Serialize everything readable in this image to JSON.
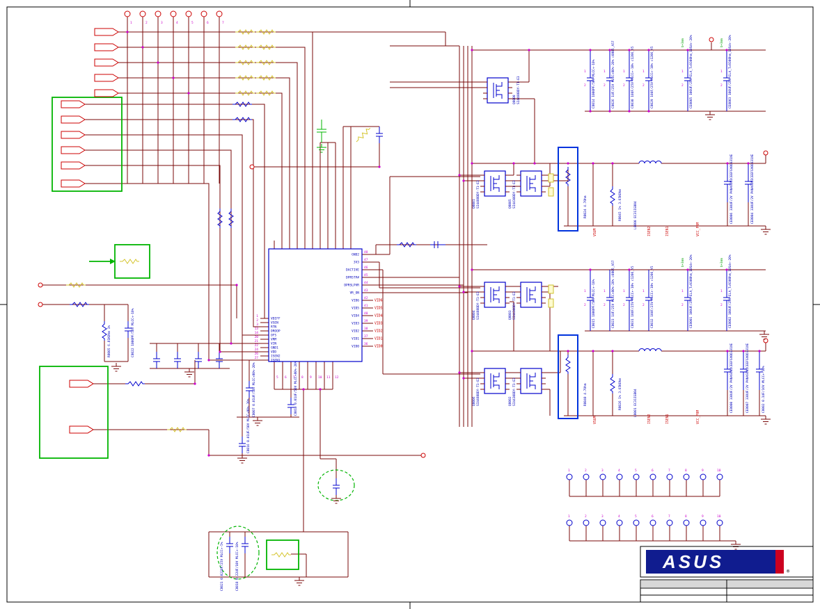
{
  "sheet": {
    "brand": "ASUS",
    "reg": "®"
  },
  "top_header": {
    "pins": [
      "1",
      "2",
      "3",
      "4",
      "5",
      "6",
      "7"
    ]
  },
  "ic": {
    "pins_right": [
      {
        "n": "48",
        "name": "GND2",
        "net": ""
      },
      {
        "n": "47",
        "name": "3V3",
        "net": ""
      },
      {
        "n": "46",
        "name": "DACTIVE",
        "net": ""
      },
      {
        "n": "45",
        "name": "DPRSTP#",
        "net": ""
      },
      {
        "n": "44",
        "name": "DPRSLPVR",
        "net": ""
      },
      {
        "n": "43",
        "name": "VR_ON",
        "net": ""
      },
      {
        "n": "42",
        "name": "VID6",
        "net": "VID6"
      },
      {
        "n": "41",
        "name": "VID5",
        "net": "VID5"
      },
      {
        "n": "40",
        "name": "VID4",
        "net": "VID4"
      },
      {
        "n": "39",
        "name": "VID3",
        "net": "VID3"
      },
      {
        "n": "38",
        "name": "VID2",
        "net": "VID2"
      },
      {
        "n": "37",
        "name": "VID1",
        "net": "VID1"
      },
      {
        "n": "36",
        "name": "VID0",
        "net": "VID0"
      }
    ],
    "pins_left": [
      {
        "n": "1",
        "name": "VDIFF"
      },
      {
        "n": "2",
        "name": "VSEN"
      },
      {
        "n": "3",
        "name": "RTN"
      },
      {
        "n": "13",
        "name": "DROOP"
      },
      {
        "n": "14",
        "name": "OFS"
      },
      {
        "n": "20",
        "name": "VRM"
      },
      {
        "n": "21",
        "name": "VIN"
      },
      {
        "n": "22",
        "name": "GND1"
      },
      {
        "n": "24",
        "name": "VDD"
      },
      {
        "n": "26",
        "name": "ISEN2"
      },
      {
        "n": "27",
        "name": "ISEN1"
      }
    ],
    "pins_bottom": [
      "5",
      "6",
      "7",
      "8",
      "9",
      "10",
      "11",
      "12"
    ]
  },
  "mosfets": [
    {
      "ref": "Q8000",
      "part": "SI4488BDY-T1-E3"
    },
    {
      "ref": "Q8001",
      "part": "SI4488BDY-T1-E3"
    },
    {
      "ref": "Q8005",
      "part": "SI4430BDY-T1-E3"
    },
    {
      "ref": "Q8004",
      "part": "SI4488BDY-T1-E3"
    },
    {
      "ref": "Q8003",
      "part": "SI4430BDY-T1-E3"
    },
    {
      "ref": "Q8006",
      "part": "SI4488BDY-T1-E3"
    },
    {
      "ref": "Q8002",
      "part": "SI4430BDY-T1-E3"
    }
  ],
  "bank1": [
    {
      "t": "C8014 1000PF/50V MLCC+-10%"
    },
    {
      "t": "C8026 1UF/25V MLCC+80%-20% c0805_A57"
    },
    {
      "t": "C8030 10UF/25V MLCC+-10% c1206_Y5"
    },
    {
      "t": "C8029 10UF/25V MLCC+-10% c1206_Y5"
    },
    {
      "t": "CE8005 100UF/25V ELA_T=9300hm_10Sd+-20%"
    },
    {
      "t": "CE8003 100UF/25V ELA_T=9300hm_10Sd+-20%"
    }
  ],
  "bank2": [
    {
      "t": "C8015 1000PF/50V MLCC+-10%"
    },
    {
      "t": "C8023 1UF/25V MLCC+80%-20% c0805_A57"
    },
    {
      "t": "C8031 10UF/25V MLCC+-10% c1206_Y5"
    },
    {
      "t": "C8032 10UF/25V MLCC+-10% c1206_Y5"
    },
    {
      "t": "CE8001 100UF/25V ELA_T=9300hm_10Sd+-20%"
    },
    {
      "t": "CE8002 100UF/25V ELA_T=9300hm_10Sd+-20%"
    }
  ],
  "phase1": {
    "r_gate": "R8024 4.7Ohm",
    "r_sense": "R8045 1% 3.65KOhm",
    "ind": "L8000 EC31IGB04",
    "c_out1": "CE8006 330UF/2V PANASONICEEFSX0D331XE",
    "c_out2": "CE8004 330UF/2V PANASONICEEFSX0D331XE",
    "net_vsum": "VSUM",
    "net_isen2": "ISEN2",
    "net_isen1": "ISEN1",
    "net_vcc": "VCC_PRM"
  },
  "phase2": {
    "r_gate": "R8040 4.7Ohm",
    "r_sense": "R8026 1% 3.65KOhm",
    "ind": "L8001 EC31IGB04",
    "c_out1": "CE8000 330UF/2V PANASONICEEFSX0D331XE",
    "c_out2": "CE8007 330UF/2V PANASONICEEFSX0D331XE",
    "c_out3": "C8002 0.1UF/16V MLCC+-10%",
    "net_vsum": "VSUM",
    "net_isen2": "ISEN2",
    "net_isen1": "ISEN1",
    "net_vcc": "VCC_PRM"
  },
  "left_parts": {
    "r8005": "R8005 6.81KOhm 1%",
    "c8022": "C8022 1000PF/50V MLCC+-10%",
    "c8007": "C8007 0.01UF/50V MLCC+80%-20%",
    "c8010": "C8010 0.01UF/50V MLCC+80%-20%",
    "c8016": "C8016 0.01UF/50V MLCC+80%-20%",
    "c8021": "C8021 0.022UF/25V MLCC+-5%",
    "c8018": "C8018 0.22UF/10V MLCC+-10%"
  },
  "notes": {
    "h": "b+3mm"
  },
  "pin": {
    "p1": "1",
    "p2": "2"
  },
  "headers": {
    "row1": [
      "1",
      "2",
      "3",
      "4",
      "5",
      "6",
      "7",
      "8",
      "9",
      "10"
    ],
    "row2": [
      "1",
      "2",
      "3",
      "4",
      "5",
      "6",
      "7",
      "8",
      "9",
      "10"
    ]
  }
}
